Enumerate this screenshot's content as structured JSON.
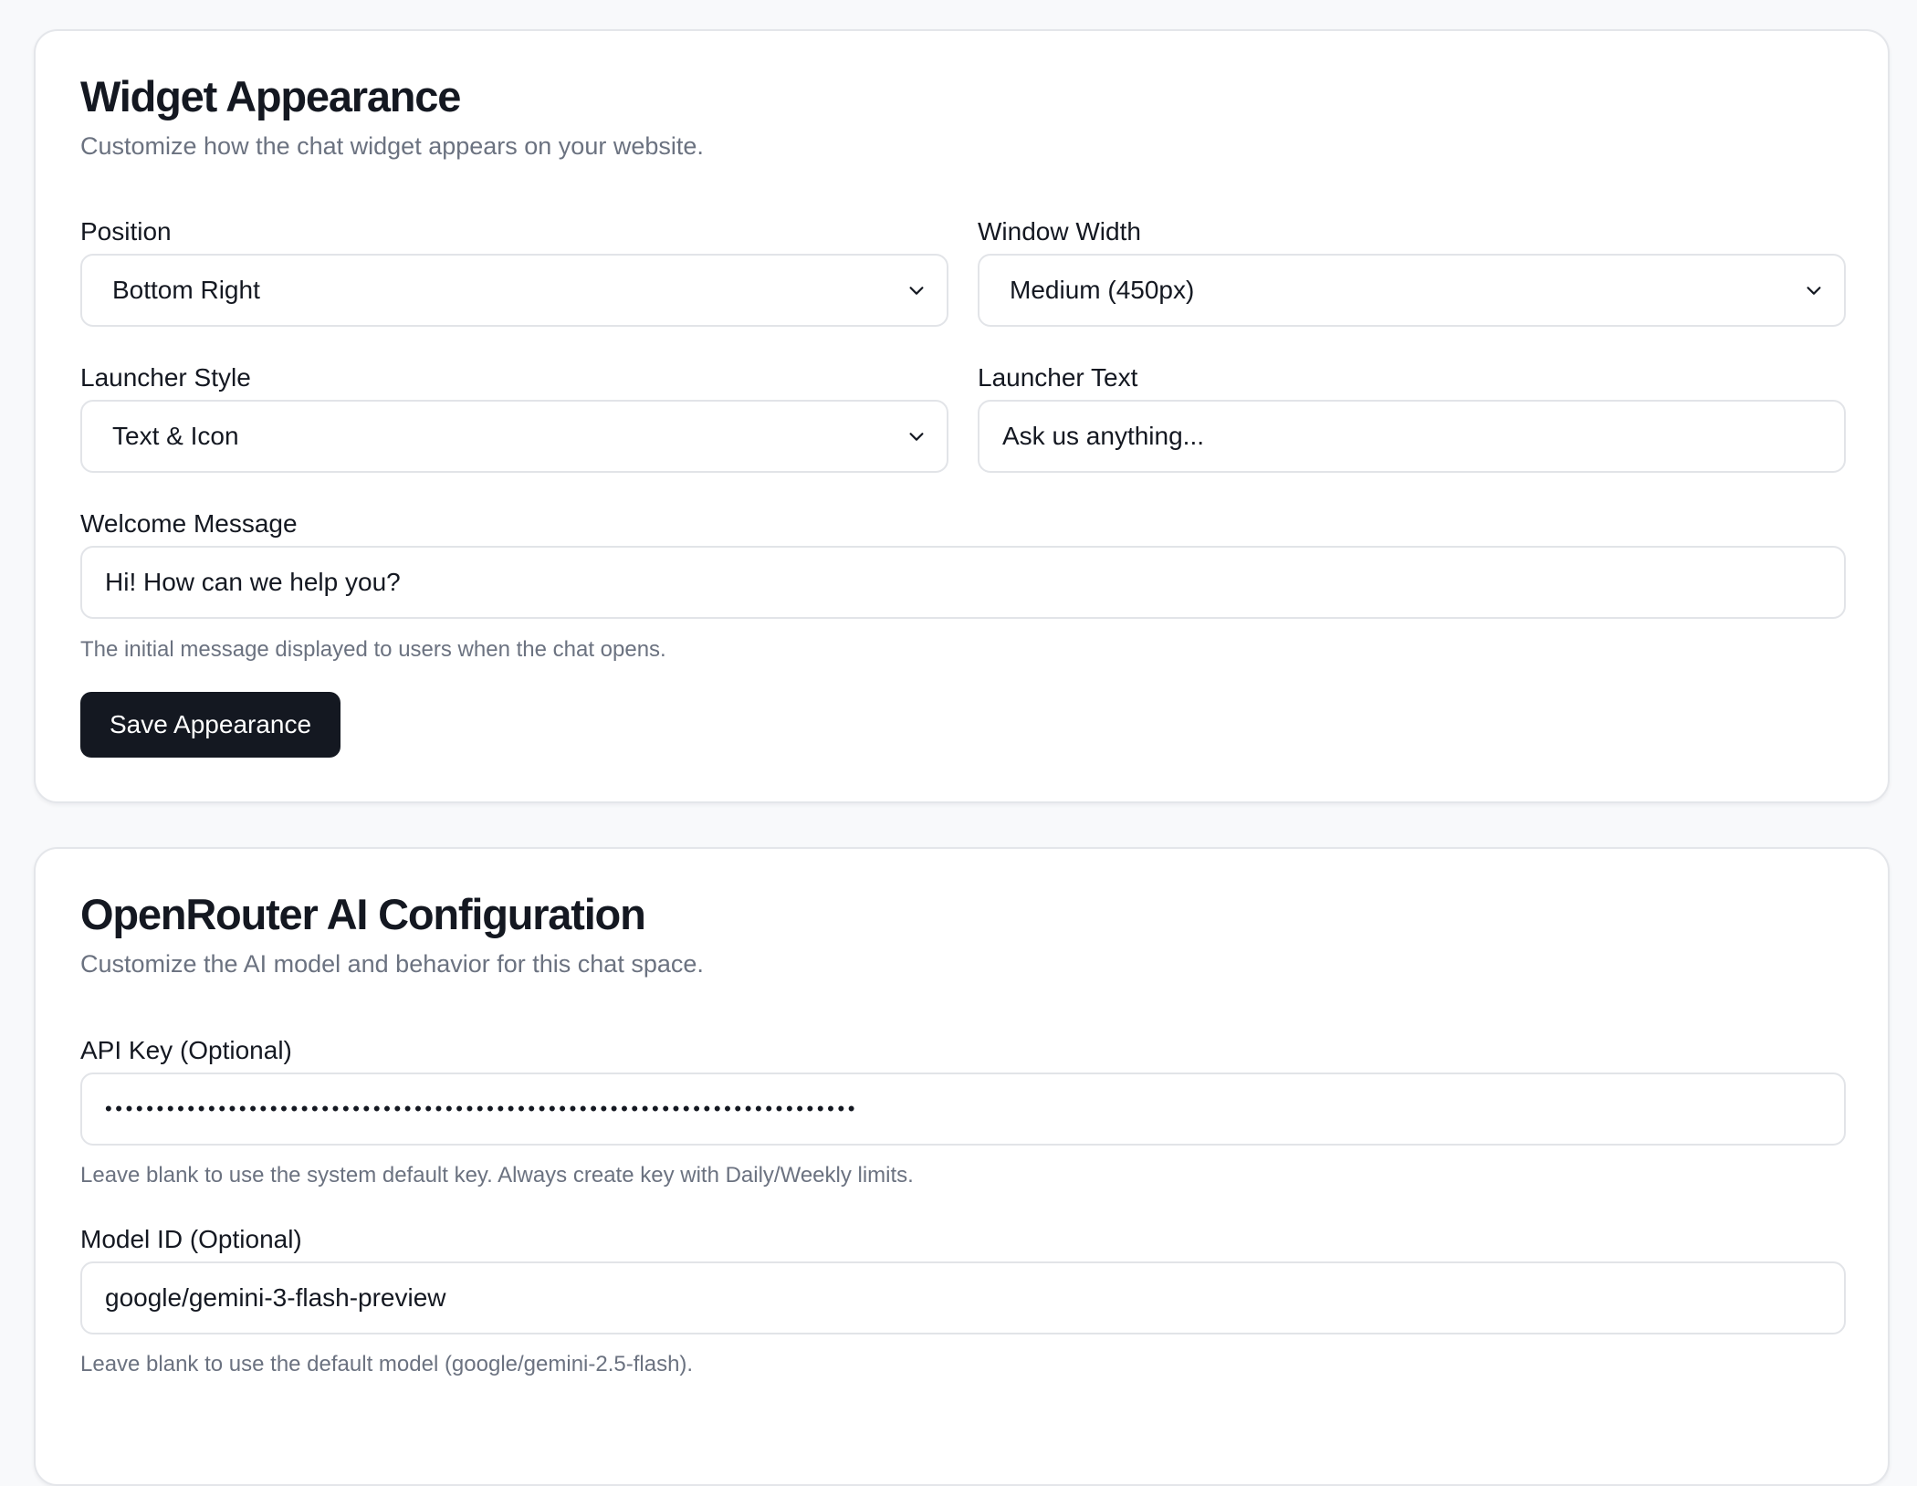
{
  "appearance": {
    "title": "Widget Appearance",
    "subtitle": "Customize how the chat widget appears on your website.",
    "position": {
      "label": "Position",
      "value": "Bottom Right"
    },
    "window_width": {
      "label": "Window Width",
      "value": "Medium (450px)"
    },
    "launcher_style": {
      "label": "Launcher Style",
      "value": "Text & Icon"
    },
    "launcher_text": {
      "label": "Launcher Text",
      "value": "Ask us anything..."
    },
    "welcome_message": {
      "label": "Welcome Message",
      "value": "Hi! How can we help you?",
      "help": "The initial message displayed to users when the chat opens."
    },
    "save_label": "Save Appearance"
  },
  "ai_config": {
    "title": "OpenRouter AI Configuration",
    "subtitle": "Customize the AI model and behavior for this chat space.",
    "api_key": {
      "label": "API Key (Optional)",
      "value": "•••••••••••••••••••••••••••••••••••••••••••••••••••••••••••••••••••••••••",
      "help": "Leave blank to use the system default key. Always create key with Daily/Weekly limits."
    },
    "model_id": {
      "label": "Model ID (Optional)",
      "value": "google/gemini-3-flash-preview",
      "help": "Leave blank to use the default model (google/gemini-2.5-flash)."
    }
  },
  "theme": {
    "button_bg": "#141821",
    "muted_text": "#6b7280",
    "border": "#e2e4e8",
    "page_bg": "#f8f9fb"
  },
  "icons": {
    "select_indicator": "chevron-down-icon"
  }
}
